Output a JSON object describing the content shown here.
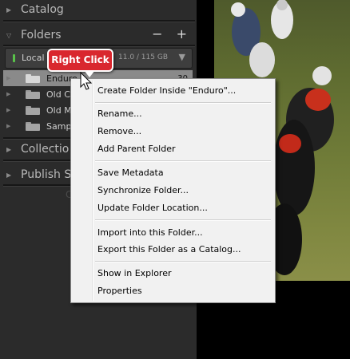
{
  "panel": {
    "catalog_label": "Catalog",
    "folders_label": "Folders",
    "header_actions": "− +",
    "volume": {
      "name": "Local",
      "size": "11.0 / 115 GB"
    },
    "folders": [
      {
        "label": "Enduro",
        "count": "30",
        "selected": true
      },
      {
        "label": "Old C"
      },
      {
        "label": "Old M"
      },
      {
        "label": "Samp"
      }
    ],
    "collections_label": "Collectio",
    "publish_label": "Publish S",
    "faint_letter": "C"
  },
  "callout": {
    "text": "Right Click",
    "color": "#d9272e"
  },
  "context_menu": {
    "create_folder": "Create Folder Inside \"Enduro\"...",
    "rename": "Rename...",
    "remove": "Remove...",
    "add_parent": "Add Parent Folder",
    "save_metadata": "Save Metadata",
    "synchronize": "Synchronize Folder...",
    "update_location": "Update Folder Location...",
    "import_into": "Import into this Folder...",
    "export_catalog": "Export this Folder as a Catalog...",
    "show_explorer": "Show in Explorer",
    "properties": "Properties"
  },
  "icons": [
    "triangle-right-icon",
    "triangle-down-icon",
    "folder-icon",
    "drive-led-icon",
    "mouse-cursor-icon",
    "plus-icon",
    "minus-icon"
  ]
}
